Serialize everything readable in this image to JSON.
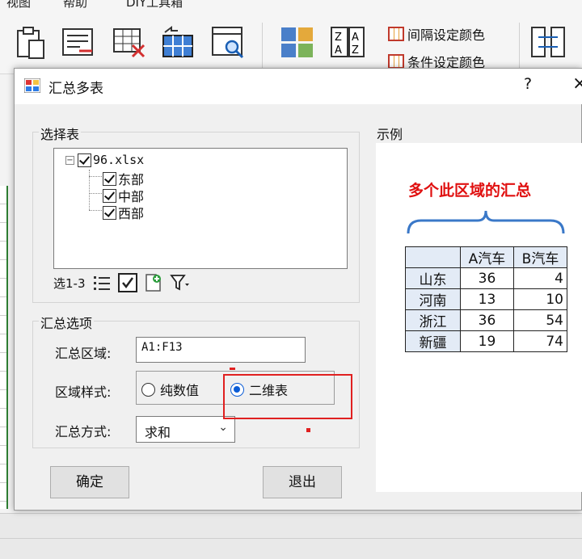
{
  "ribbon": {
    "tabs": [
      "视图",
      "帮助",
      "DIY工具箱"
    ],
    "small_buttons": [
      "间隔设定颜色",
      "条件设定颜色"
    ],
    "icons": [
      "clipboard-icon",
      "list-icon",
      "grid-delete-icon",
      "grid-swap-icon",
      "table-search-icon",
      "color-blocks-icon",
      "sort-az-icon",
      "exchange-icon"
    ]
  },
  "dialog": {
    "title": "汇总多表",
    "help": "?",
    "close": "×",
    "select_group": {
      "label": "选择表",
      "tree": {
        "file": "96.xlsx",
        "expander": "−",
        "sheets": [
          "东部",
          "中部",
          "西部"
        ]
      },
      "toolbar": {
        "range_text": "选1-3",
        "icons": [
          "list-icon",
          "check-all-icon",
          "add-file-icon",
          "filter-icon"
        ]
      }
    },
    "options_group": {
      "label": "汇总选项",
      "area_label": "汇总区域:",
      "area_value": "A1:F13",
      "style_label": "区域样式:",
      "style_options": [
        "纯数值",
        "二维表"
      ],
      "style_selected": "二维表",
      "method_label": "汇总方式:",
      "method_value": "求和",
      "method_chevron": "⌄"
    },
    "ok_button": "确定",
    "exit_button": "退出",
    "sample_group": {
      "label": "示例",
      "caption": "多个此区域的汇总",
      "table": {
        "headers": [
          "",
          "A汽车",
          "B汽车"
        ],
        "rows": [
          [
            "山东",
            "36",
            "4"
          ],
          [
            "河南",
            "13",
            "10"
          ],
          [
            "浙江",
            "36",
            "54"
          ],
          [
            "新疆",
            "19",
            "74"
          ]
        ]
      }
    }
  },
  "colors": {
    "highlight_red": "#e02020",
    "caption_red": "#e01010",
    "radio_blue": "#0b5cd6",
    "header_fill": "#e3ebf6"
  }
}
